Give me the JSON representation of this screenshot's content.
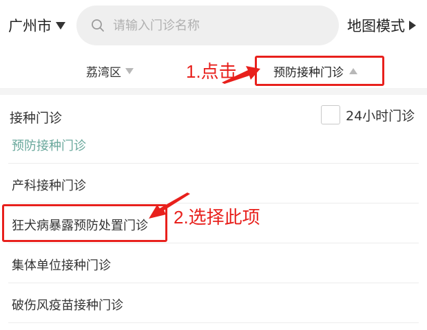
{
  "header": {
    "city": "广州市",
    "search_placeholder": "请输入门诊名称",
    "map_mode": "地图模式"
  },
  "filters": {
    "district": "荔湾区",
    "clinic_type": "预防接种门诊"
  },
  "annotations": {
    "step1": "1.点击",
    "step2": "2.选择此项",
    "color": "#e8201c"
  },
  "panel": {
    "title": "接种门诊",
    "checkbox_label": "24小时门诊",
    "options": [
      {
        "label": "预防接种门诊",
        "selected": true
      },
      {
        "label": "产科接种门诊",
        "selected": false
      },
      {
        "label": "狂犬病暴露预防处置门诊",
        "selected": false
      },
      {
        "label": "集体单位接种门诊",
        "selected": false
      },
      {
        "label": "破伤风疫苗接种门诊",
        "selected": false
      }
    ]
  },
  "colors": {
    "selected_text": "#6aa89c",
    "search_bg": "#efefef"
  }
}
